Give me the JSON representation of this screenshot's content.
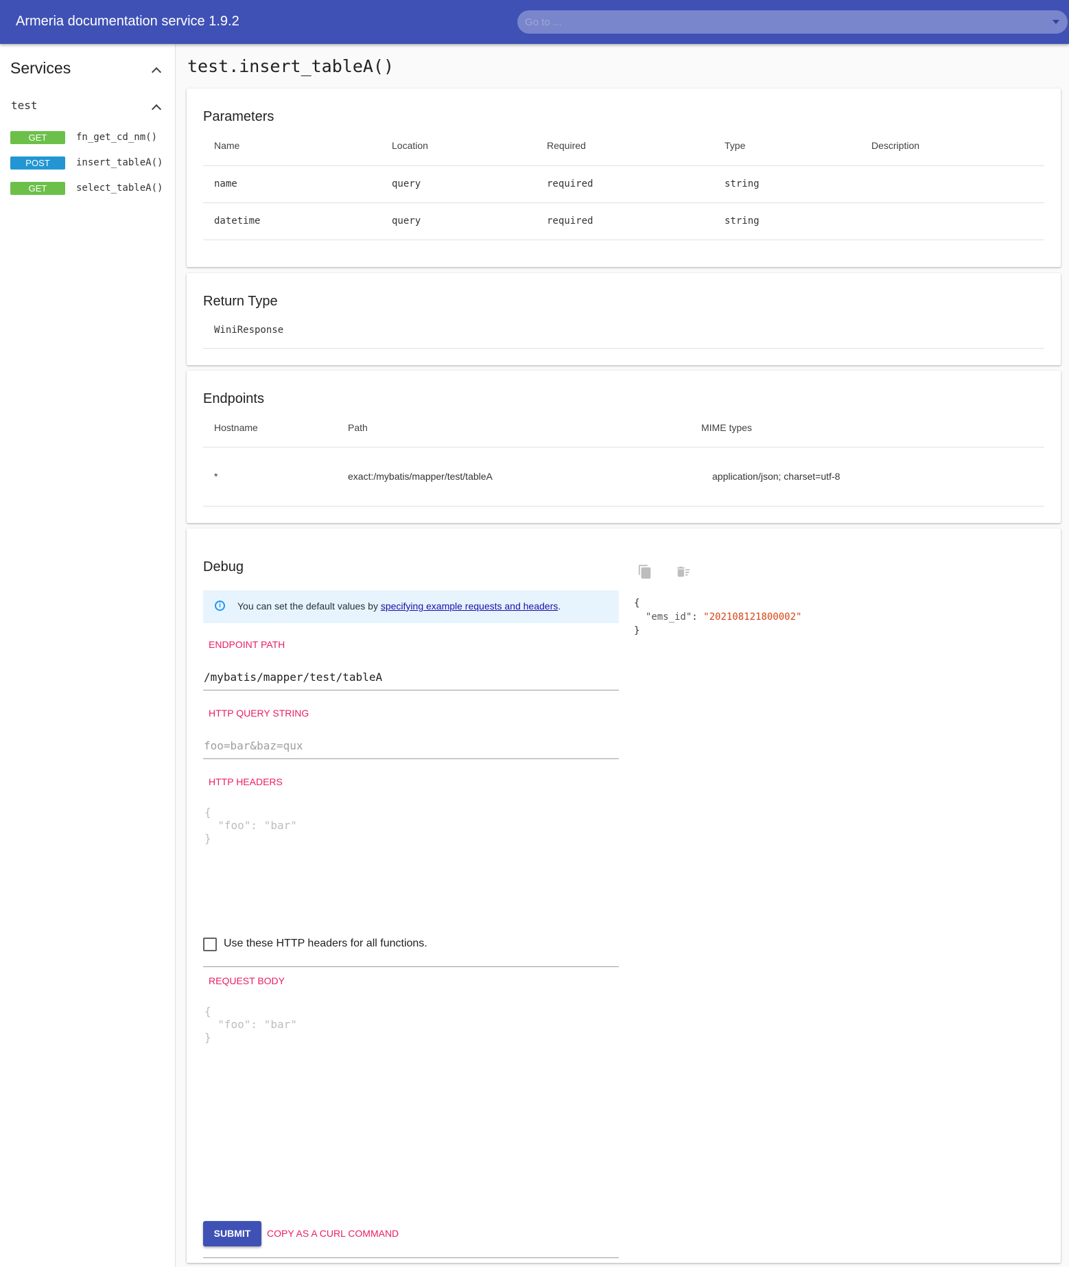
{
  "appbar": {
    "title": "Armeria documentation service 1.9.2",
    "goto_placeholder": "Go to ..."
  },
  "sidebar": {
    "header": "Services",
    "service_name": "test",
    "functions": [
      {
        "method": "GET",
        "name": "fn_get_cd_nm()"
      },
      {
        "method": "POST",
        "name": "insert_tableA()"
      },
      {
        "method": "GET",
        "name": "select_tableA()"
      }
    ]
  },
  "main": {
    "title": "test.insert_tableA()",
    "parameters": {
      "title": "Parameters",
      "headers": [
        "Name",
        "Location",
        "Required",
        "Type",
        "Description"
      ],
      "rows": [
        [
          "name",
          "query",
          "required",
          "string",
          ""
        ],
        [
          "datetime",
          "query",
          "required",
          "string",
          ""
        ]
      ]
    },
    "return_type": {
      "title": "Return Type",
      "value": "WiniResponse"
    },
    "endpoints": {
      "title": "Endpoints",
      "headers": [
        "Hostname",
        "Path",
        "MIME types"
      ],
      "rows": [
        [
          "*",
          "exact:/mybatis/mapper/test/tableA",
          "application/json; charset=utf-8"
        ]
      ]
    },
    "debug": {
      "title": "Debug",
      "info_text": "You can set the default values by ",
      "info_link": "specifying example requests and headers",
      "info_suffix": ".",
      "endpoint_path_label": "ENDPOINT PATH",
      "endpoint_path_value": "/mybatis/mapper/test/tableA",
      "query_label": "HTTP QUERY STRING",
      "query_placeholder": "foo=bar&baz=qux",
      "headers_label": "HTTP HEADERS",
      "headers_placeholder": "{\n  \"foo\": \"bar\"\n}",
      "checkbox_label": "Use these HTTP headers for all functions.",
      "body_label": "REQUEST BODY",
      "body_placeholder": "{\n  \"foo\": \"bar\"\n}",
      "submit_label": "SUBMIT",
      "curl_label": "COPY AS A CURL COMMAND",
      "response": {
        "open": "{",
        "key": "\"ems_id\"",
        "colon": ": ",
        "value": "\"202108121800002\"",
        "close": "}"
      }
    }
  },
  "colors": {
    "primary": "#3f51b5",
    "accent": "#e91e63",
    "get_badge": "#6cc04a",
    "post_badge": "#2196d3"
  }
}
